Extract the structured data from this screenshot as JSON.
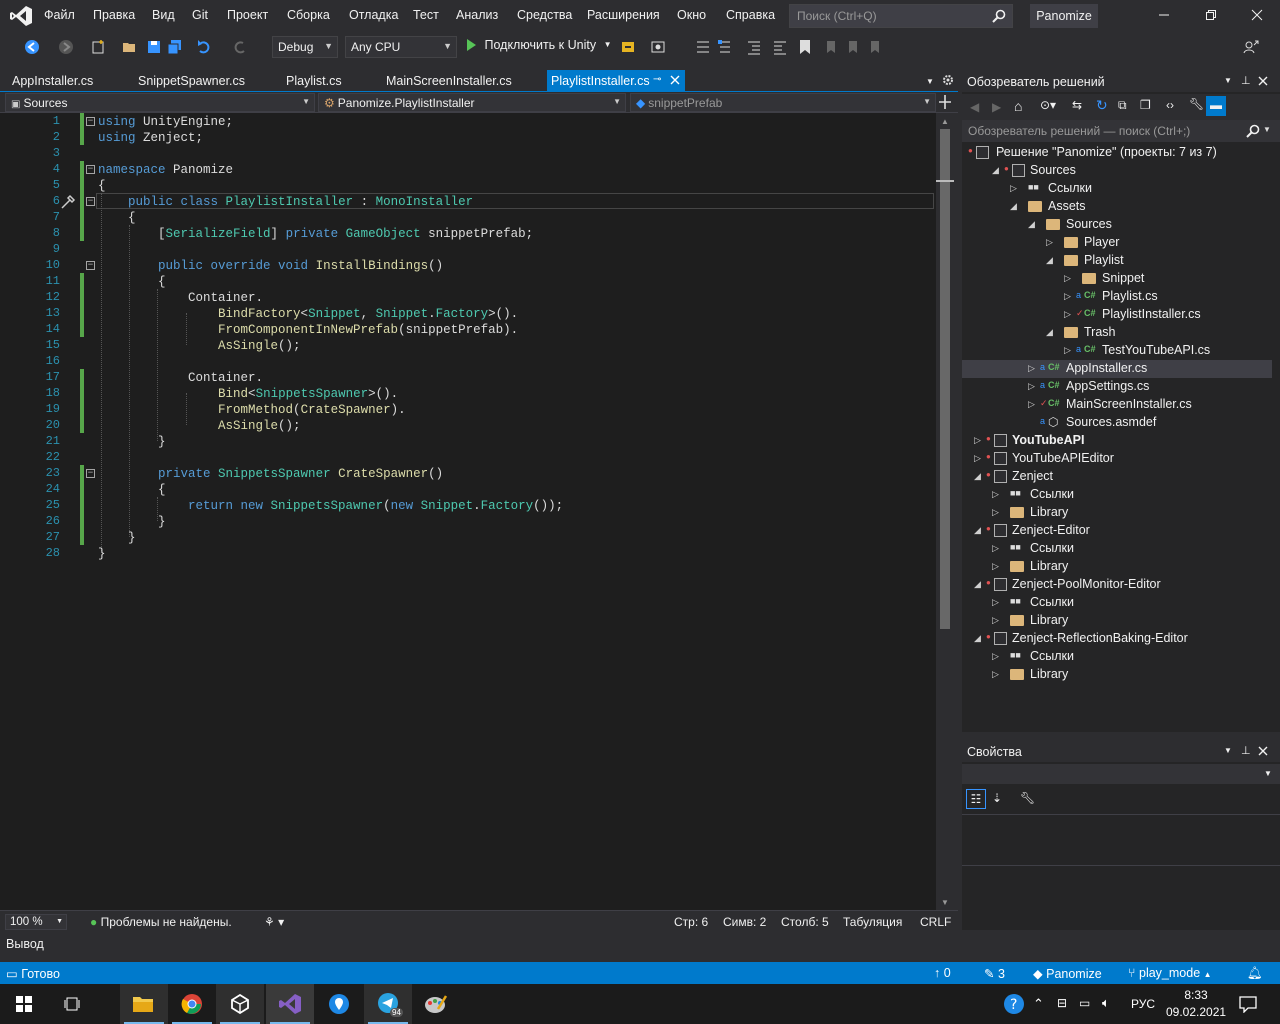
{
  "menu": [
    "Файл",
    "Правка",
    "Вид",
    "Git",
    "Проект",
    "Сборка",
    "Отладка",
    "Тест",
    "Анализ",
    "Средства",
    "Расширения",
    "Окно",
    "Справка"
  ],
  "search": {
    "placeholder": "Поиск (Ctrl+Q)"
  },
  "project_name": "Panomize",
  "toolbar": {
    "config": "Debug",
    "platform": "Any CPU",
    "attach": "Подключить к Unity"
  },
  "tabs": [
    {
      "label": "AppInstaller.cs"
    },
    {
      "label": "SnippetSpawner.cs"
    },
    {
      "label": "Playlist.cs"
    },
    {
      "label": "MainScreenInstaller.cs"
    },
    {
      "label": "PlaylistInstaller.cs",
      "active": true
    }
  ],
  "nav": {
    "project": "Sources",
    "type": "Panomize.PlaylistInstaller",
    "member": "snippetPrefab"
  },
  "editor": {
    "line_numbers": [
      "1",
      "2",
      "3",
      "4",
      "5",
      "6",
      "7",
      "8",
      "9",
      "10",
      "11",
      "12",
      "13",
      "14",
      "15",
      "16",
      "17",
      "18",
      "19",
      "20",
      "21",
      "22",
      "23",
      "24",
      "25",
      "26",
      "27",
      "28"
    ]
  },
  "editor_status": {
    "zoom": "100 %",
    "problems": "Проблемы не найдены.",
    "line": "Стр: 6",
    "char": "Симв: 2",
    "col": "Столб: 5",
    "tabs": "Табуляция",
    "eol": "CRLF"
  },
  "output_tab": "Вывод",
  "statusbar": {
    "ready": "Готово",
    "up": "0",
    "edits": "3",
    "repo": "Panomize",
    "branch": "play_mode"
  },
  "taskbar": {
    "lang": "РУС",
    "time": "8:33",
    "date": "09.02.2021",
    "badge": "94"
  },
  "solution": {
    "title": "Обозреватель решений",
    "search_placeholder": "Обозреватель решений — поиск (Ctrl+;)",
    "root": "Решение \"Panomize\" (проекты: 7 из 7)",
    "items": [
      {
        "label": "Sources",
        "kind": "project"
      },
      {
        "label": "Ссылки",
        "kind": "refs"
      },
      {
        "label": "Assets",
        "kind": "folder"
      },
      {
        "label": "Sources",
        "kind": "folder"
      },
      {
        "label": "Player",
        "kind": "folder"
      },
      {
        "label": "Playlist",
        "kind": "folder"
      },
      {
        "label": "Snippet",
        "kind": "folder"
      },
      {
        "label": "Playlist.cs",
        "kind": "cs"
      },
      {
        "label": "PlaylistInstaller.cs",
        "kind": "cs"
      },
      {
        "label": "Trash",
        "kind": "folder"
      },
      {
        "label": "TestYouTubeAPI.cs",
        "kind": "cs"
      },
      {
        "label": "AppInstaller.cs",
        "kind": "cs",
        "selected": true
      },
      {
        "label": "AppSettings.cs",
        "kind": "cs"
      },
      {
        "label": "MainScreenInstaller.cs",
        "kind": "cs"
      },
      {
        "label": "Sources.asmdef",
        "kind": "asmdef"
      },
      {
        "label": "YouTubeAPI",
        "kind": "project",
        "bold": true
      },
      {
        "label": "YouTubeAPIEditor",
        "kind": "project"
      },
      {
        "label": "Zenject",
        "kind": "project"
      },
      {
        "label": "Ссылки",
        "kind": "refs"
      },
      {
        "label": "Library",
        "kind": "folder"
      },
      {
        "label": "Zenject-Editor",
        "kind": "project"
      },
      {
        "label": "Ссылки",
        "kind": "refs"
      },
      {
        "label": "Library",
        "kind": "folder"
      },
      {
        "label": "Zenject-PoolMonitor-Editor",
        "kind": "project"
      },
      {
        "label": "Ссылки",
        "kind": "refs"
      },
      {
        "label": "Library",
        "kind": "folder"
      },
      {
        "label": "Zenject-ReflectionBaking-Editor",
        "kind": "project"
      },
      {
        "label": "Ссылки",
        "kind": "refs"
      },
      {
        "label": "Library",
        "kind": "folder"
      }
    ]
  },
  "properties": {
    "title": "Свойства"
  },
  "colors": {
    "accent": "#007acc",
    "editor_bg": "#1e1e1e",
    "keyword": "#569cd6",
    "type": "#4ec9b0",
    "method": "#dcdcaa",
    "line_number": "#2b91af"
  }
}
